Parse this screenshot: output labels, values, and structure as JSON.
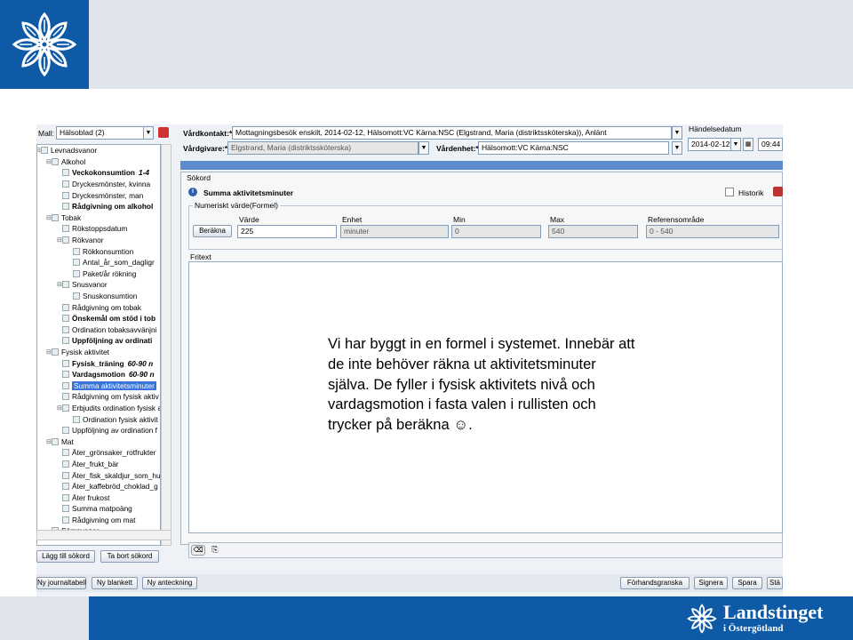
{
  "window": {
    "mall_label": "Mall:",
    "mall_value": "Hälsoblad (2)",
    "vardkontakt_label": "Vårdkontakt:*",
    "vardkontakt_value": "Mottagningsbesök enskilt, 2014-02-12, Hälsomott:VC Kärna:NSC (Elgstrand, Maria (distriktssköterska)), Anlänt",
    "vardgivare_label": "Vårdgivare:*",
    "vardgivare_value": "Elgstrand, Maria (distriktssköterska)",
    "vardenhet_label": "Vårdenhet:*",
    "vardenhet_value": "Hälsomott:VC Kärna:NSC",
    "handelse_label": "Händelsedatum",
    "handelse_date": "2014-02-12",
    "handelse_time": "09:44"
  },
  "tree": [
    {
      "label": "Levnadsvanor",
      "level": 0,
      "toggle": "⊟"
    },
    {
      "label": "Alkohol",
      "level": 1,
      "toggle": "⊟"
    },
    {
      "label": "Veckokonsumtion",
      "level": 2,
      "bold": true,
      "num": "1-4"
    },
    {
      "label": "Dryckesmönster, kvinna",
      "level": 2
    },
    {
      "label": "Dryckesmönster, man",
      "level": 2
    },
    {
      "label": "Rådgivning om alkohol",
      "level": 2,
      "bold": true
    },
    {
      "label": "Tobak",
      "level": 1,
      "toggle": "⊟"
    },
    {
      "label": "Rökstoppsdatum",
      "level": 2
    },
    {
      "label": "Rökvanor",
      "level": 2,
      "toggle": "⊟"
    },
    {
      "label": "Rökkonsumtion",
      "level": 3
    },
    {
      "label": "Antal_år_som_dagligr",
      "level": 3
    },
    {
      "label": "Paket/år rökning",
      "level": 3
    },
    {
      "label": "Snusvanor",
      "level": 2,
      "toggle": "⊟"
    },
    {
      "label": "Snuskonsumtion",
      "level": 3
    },
    {
      "label": "Rådgivning om tobak",
      "level": 2
    },
    {
      "label": "Önskemål om stöd i tob",
      "level": 2,
      "bold": true
    },
    {
      "label": "Ordination tobaksavvänjni",
      "level": 2
    },
    {
      "label": "Uppföljning av ordinati",
      "level": 2,
      "bold": true
    },
    {
      "label": "Fysisk aktivitet",
      "level": 1,
      "toggle": "⊟"
    },
    {
      "label": "Fysisk_träning",
      "level": 2,
      "bold": true,
      "num": "60-90 n"
    },
    {
      "label": "Vardagsmotion",
      "level": 2,
      "bold": true,
      "num": "60-90 n"
    },
    {
      "label": "Summa aktivitetsminuter",
      "level": 2,
      "selected": true
    },
    {
      "label": "Rådgivning om fysisk aktiv",
      "level": 2
    },
    {
      "label": "Erbjudits ordination fysisk a",
      "level": 2,
      "toggle": "⊟"
    },
    {
      "label": "Ordination fysisk aktivit",
      "level": 3
    },
    {
      "label": "Uppföljning av ordination f",
      "level": 2
    },
    {
      "label": "Mat",
      "level": 1,
      "toggle": "⊟"
    },
    {
      "label": "Äter_grönsaker_rotfrukter",
      "level": 2
    },
    {
      "label": "Äter_frukt_bär",
      "level": 2
    },
    {
      "label": "Äter_fisk_skaldjur_som_hu",
      "level": 2
    },
    {
      "label": "Äter_kaffebröd_choklad_g",
      "level": 2
    },
    {
      "label": "Äter frukost",
      "level": 2
    },
    {
      "label": "Summa matpoäng",
      "level": 2
    },
    {
      "label": "Rådgivning om mat",
      "level": 2
    },
    {
      "label": "Sömnvanor",
      "level": 1
    }
  ],
  "buttons": {
    "lagg_till": "Lägg till sökord",
    "ta_bort": "Ta bort sökord",
    "ny_journaltabell": "Ny journaltabell",
    "ny_blankett": "Ny blankett",
    "ny_anteckning": "Ny anteckning",
    "forhandsgranska": "Förhandsgranska",
    "signera": "Signera",
    "spara": "Spara",
    "stang": "Stä",
    "berakna": "Beräkna"
  },
  "sokord": {
    "title": "Sökord",
    "item_title": "Summa aktivitetsminuter",
    "historik": "Historik",
    "group_title": "Numeriskt värde(Formel)",
    "col_varde": "Värde",
    "col_enhet": "Enhet",
    "col_min": "Min",
    "col_max": "Max",
    "col_ref": "Referensområde",
    "val_varde": "225",
    "val_enhet": "minuter",
    "val_min": "0",
    "val_max": "540",
    "val_ref": "0 - 540",
    "fritext": "Fritext"
  },
  "overlay_text": "Vi har byggt in en formel i systemet. Innebär att de inte behöver räkna ut aktivitetsminuter själva. De fyller i fysisk aktivitets nivå och vardagsmotion i fasta valen i rullisten och trycker på beräkna ☺.",
  "brand": {
    "name": "Landstinget",
    "sub": "i Östergötland"
  },
  "colors": {
    "brand_blue": "#0f5aa6",
    "band_gray": "#dfe3ec",
    "selection": "#3875d7"
  }
}
